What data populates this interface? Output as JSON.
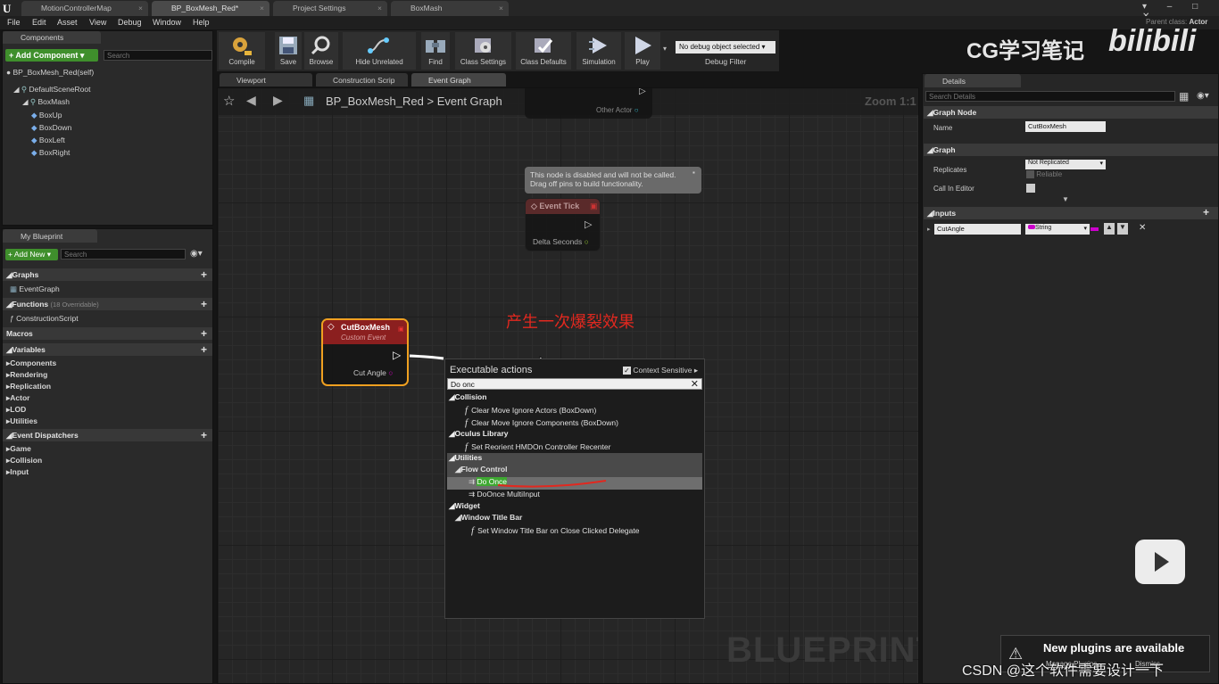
{
  "window": {
    "tabs": [
      "MotionControllerMap",
      "BP_BoxMesh_Red*",
      "Project Settings",
      "BoxMash"
    ],
    "parent_class_label": "Parent class:",
    "parent_class_value": "Actor"
  },
  "menu": [
    "File",
    "Edit",
    "Asset",
    "View",
    "Debug",
    "Window",
    "Help"
  ],
  "components": {
    "tab": "Components",
    "add_label": "+ Add Component ▾",
    "search_placeholder": "Search",
    "self": "BP_BoxMesh_Red(self)",
    "items": [
      "DefaultSceneRoot",
      "BoxMash",
      "BoxUp",
      "BoxDown",
      "BoxLeft",
      "BoxRight"
    ]
  },
  "my_blueprint": {
    "tab": "My Blueprint",
    "add_new": "+ Add New ▾",
    "search_placeholder": "Search",
    "graphs": "Graphs",
    "event_graph": "EventGraph",
    "functions": "Functions",
    "functions_note": "(18 Overridable)",
    "construction_script": "ConstructionScript",
    "macros": "Macros",
    "variables": "Variables",
    "var_cats": [
      "Components",
      "Rendering",
      "Replication",
      "Actor",
      "LOD",
      "Utilities"
    ],
    "event_dispatchers": "Event Dispatchers",
    "dispatcher_cats": [
      "Game",
      "Collision",
      "Input"
    ]
  },
  "toolbar": {
    "buttons": [
      "Compile",
      "Save",
      "Browse",
      "Hide Unrelated",
      "Find",
      "Class Settings",
      "Class Defaults",
      "Simulation",
      "Play"
    ],
    "debug_object": "No debug object selected ▾",
    "debug_filter": "Debug Filter"
  },
  "graph_tabs": [
    "Viewport",
    "Construction Scrip",
    "Event Graph"
  ],
  "breadcrumb": {
    "blueprint": "BP_BoxMesh_Red",
    "sep": ">",
    "graph": "Event Graph",
    "zoom": "Zoom 1:1"
  },
  "nodes": {
    "other_actor": "Other Actor",
    "disabled_note": "This node is disabled and will not be called.\nDrag off pins to build functionality.",
    "event_tick": "Event Tick",
    "delta_seconds": "Delta Seconds",
    "cutbox_title": "CutBoxMesh",
    "cutbox_sub": "Custom Event",
    "cut_angle": "Cut Angle"
  },
  "annotation": "产生一次爆裂效果",
  "context_menu": {
    "title": "Executable actions",
    "context_sensitive": "Context Sensitive",
    "query": "Do onc",
    "rows": [
      {
        "label": "Collision",
        "kind": "cat"
      },
      {
        "label": "Clear Move Ignore Actors (BoxDown)",
        "kind": "fn"
      },
      {
        "label": "Clear Move Ignore Components (BoxDown)",
        "kind": "fn"
      },
      {
        "label": "Oculus Library",
        "kind": "cat"
      },
      {
        "label": "Set Reorient HMDOn Controller Recenter",
        "kind": "fn"
      },
      {
        "label": "Utilities",
        "kind": "cat"
      },
      {
        "label": "Flow Control",
        "kind": "subcat"
      },
      {
        "label": "Do Once",
        "kind": "macro"
      },
      {
        "label": "DoOnce MultiInput",
        "kind": "macro"
      },
      {
        "label": "Widget",
        "kind": "cat"
      },
      {
        "label": "Window Title Bar",
        "kind": "subcat"
      },
      {
        "label": "Set Window Title Bar on Close Clicked Delegate",
        "kind": "fn"
      }
    ]
  },
  "watermark": "BLUEPRINT",
  "details": {
    "tab": "Details",
    "search_placeholder": "Search Details",
    "graph_node": "Graph Node",
    "name_label": "Name",
    "name_value": "CutBoxMesh",
    "graph": "Graph",
    "replicates_label": "Replicates",
    "replicates_value": "Not Replicated",
    "reliable": "Reliable",
    "call_in_editor": "Call In Editor",
    "inputs": "Inputs",
    "input_name": "CutAngle",
    "input_type": "String"
  },
  "overlay": {
    "logo_text": "CG学习笔记",
    "logo_brand": "bilibili",
    "plugins": "New plugins are available",
    "manage": "Manage Plugins",
    "dismiss": "Dismiss",
    "csdn": "CSDN @这个软件需要设计一下"
  }
}
